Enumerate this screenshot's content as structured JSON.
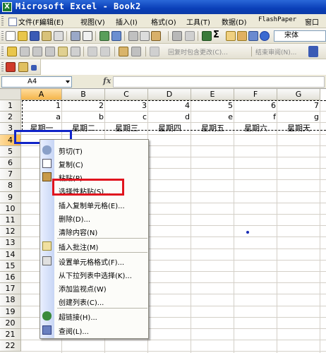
{
  "window": {
    "title": "Microsoft Excel - Book2",
    "logo_glyph": "X"
  },
  "menubar": {
    "items": [
      {
        "name": "menu-file",
        "label": "文件(F)"
      },
      {
        "name": "menu-edit",
        "label": "编辑(E)"
      },
      {
        "name": "menu-view",
        "label": "视图(V)"
      },
      {
        "name": "menu-insert",
        "label": "插入(I)"
      },
      {
        "name": "menu-format",
        "label": "格式(O)"
      },
      {
        "name": "menu-tools",
        "label": "工具(T)"
      },
      {
        "name": "menu-data",
        "label": "数据(D)"
      },
      {
        "name": "menu-flashpaper",
        "label": "FlashPaper"
      },
      {
        "name": "menu-window",
        "label": "窗口"
      }
    ]
  },
  "toolbar": {
    "font_name": "宋体",
    "sigma_glyph": "Σ",
    "review_reply_label": "回复时包含更改(C)...",
    "end_review_label": "结束审阅(N)..."
  },
  "formula": {
    "name_box": "A4",
    "fx_label": "fx",
    "value": ""
  },
  "grid": {
    "columns": [
      "A",
      "B",
      "C",
      "D",
      "E",
      "F",
      "G"
    ],
    "selected_column": "A",
    "rows": [
      "1",
      "2",
      "3",
      "4",
      "5",
      "6",
      "7",
      "8",
      "9",
      "10",
      "11",
      "12",
      "13",
      "14",
      "15",
      "16",
      "17",
      "18",
      "19",
      "20",
      "21",
      "22"
    ],
    "selected_row": "4",
    "row1": [
      "1",
      "2",
      "3",
      "4",
      "5",
      "6",
      "7"
    ],
    "row2": [
      "a",
      "b",
      "c",
      "d",
      "e",
      "f",
      "g"
    ],
    "row3": [
      "星期一",
      "星期二",
      "星期三",
      "星期四",
      "星期五",
      "星期六",
      "星期天"
    ]
  },
  "context_menu": {
    "items": [
      {
        "name": "menu-cut",
        "label": "剪切(T)",
        "icon": "scissors-icon"
      },
      {
        "name": "menu-copy",
        "label": "复制(C)",
        "icon": "copy-icon"
      },
      {
        "name": "menu-paste",
        "label": "粘贴(P)",
        "icon": "paste-icon"
      },
      {
        "name": "menu-paste-special",
        "label": "选择性粘贴(S)...",
        "icon": ""
      },
      {
        "name": "menu-insert-copied-cells",
        "label": "插入复制单元格(E)...",
        "icon": ""
      },
      {
        "name": "menu-delete",
        "label": "删除(D)...",
        "icon": ""
      },
      {
        "name": "menu-clear-contents",
        "label": "清除内容(N)",
        "icon": ""
      },
      {
        "name": "menu-insert-comment",
        "label": "插入批注(M)",
        "icon": "comment-icon"
      },
      {
        "name": "menu-format-cells",
        "label": "设置单元格格式(F)...",
        "icon": "format-cells-icon"
      },
      {
        "name": "menu-pick-from-list",
        "label": "从下拉列表中选择(K)...",
        "icon": ""
      },
      {
        "name": "menu-add-watch",
        "label": "添加监视点(W)",
        "icon": ""
      },
      {
        "name": "menu-create-list",
        "label": "创建列表(C)...",
        "icon": ""
      },
      {
        "name": "menu-hyperlink",
        "label": "超链接(H)...",
        "icon": "hyperlink-icon"
      },
      {
        "name": "menu-lookup",
        "label": "查阅(L)...",
        "icon": "lookup-icon"
      }
    ]
  },
  "colors": {
    "title_bar": "#0a3fb8",
    "highlight_red": "#e0141e",
    "highlight_blue": "#1024c8",
    "selection_header": "#f5b54a"
  }
}
